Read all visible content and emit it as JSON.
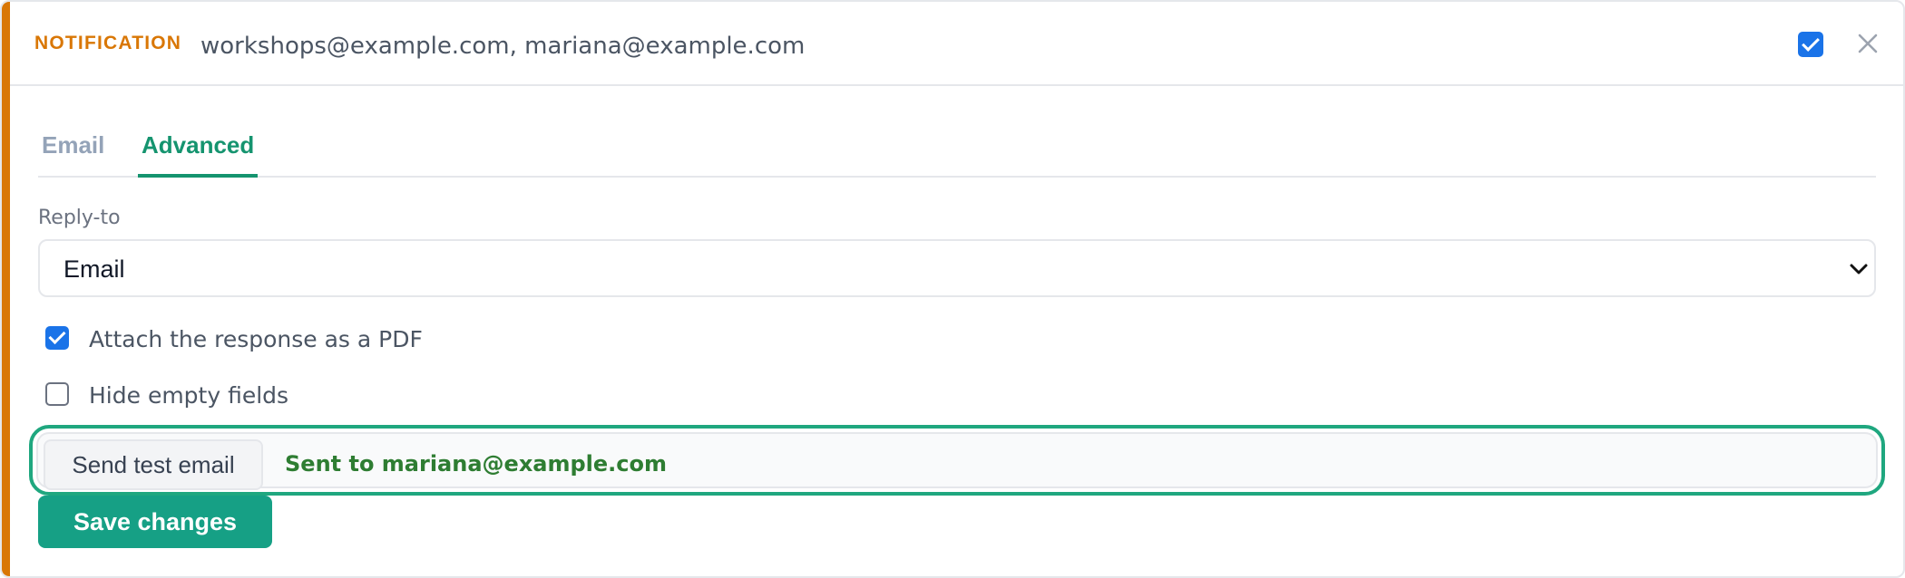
{
  "header": {
    "label": "NOTIFICATION",
    "recipients": "workshops@example.com, mariana@example.com",
    "enabled": true,
    "close_icon": "close-icon"
  },
  "tabs": [
    {
      "label": "Email",
      "active": false
    },
    {
      "label": "Advanced",
      "active": true
    }
  ],
  "reply_to": {
    "label": "Reply-to",
    "selected": "Email"
  },
  "options": [
    {
      "label": "Attach the response as a PDF",
      "checked": true
    },
    {
      "label": "Hide empty fields",
      "checked": false
    }
  ],
  "test": {
    "button_label": "Send test email",
    "status": "Sent to mariana@example.com"
  },
  "save_label": "Save changes",
  "colors": {
    "accent": "#d97706",
    "primary": "#16a085",
    "checkbox": "#1a73e8",
    "success_text": "#2e7d32"
  }
}
